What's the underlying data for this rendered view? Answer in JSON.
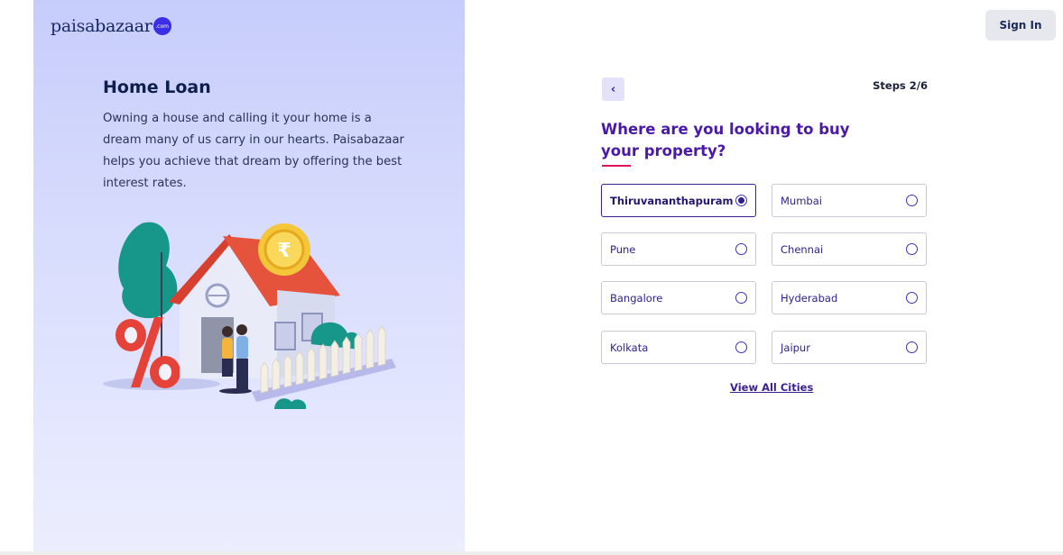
{
  "brand": {
    "logo_text_a": "paisa",
    "logo_text_b": "bazaar",
    "logo_badge": ".com"
  },
  "header": {
    "signin_label": "Sign In"
  },
  "hero": {
    "title": "Home Loan",
    "description": "Owning a house and calling it your home is a dream many of us carry in our hearts. Paisabazaar helps you achieve that dream by offering the best interest rates."
  },
  "form": {
    "back_label": "‹",
    "steps": "Steps 2/6",
    "question": "Where are you looking to buy your property?",
    "cities": [
      {
        "label": "Thiruvananthapuram",
        "selected": true
      },
      {
        "label": "Mumbai",
        "selected": false
      },
      {
        "label": "Pune",
        "selected": false
      },
      {
        "label": "Chennai",
        "selected": false
      },
      {
        "label": "Bangalore",
        "selected": false
      },
      {
        "label": "Hyderabad",
        "selected": false
      },
      {
        "label": "Kolkata",
        "selected": false
      },
      {
        "label": "Jaipur",
        "selected": false
      }
    ],
    "view_all_label": "View All Cities"
  },
  "illustration": {
    "currency_symbol": "₹",
    "percent_symbol": "%"
  },
  "colors": {
    "accent": "#4a1aa7",
    "underline": "#e0145b",
    "panel": "#c7cdfb"
  }
}
